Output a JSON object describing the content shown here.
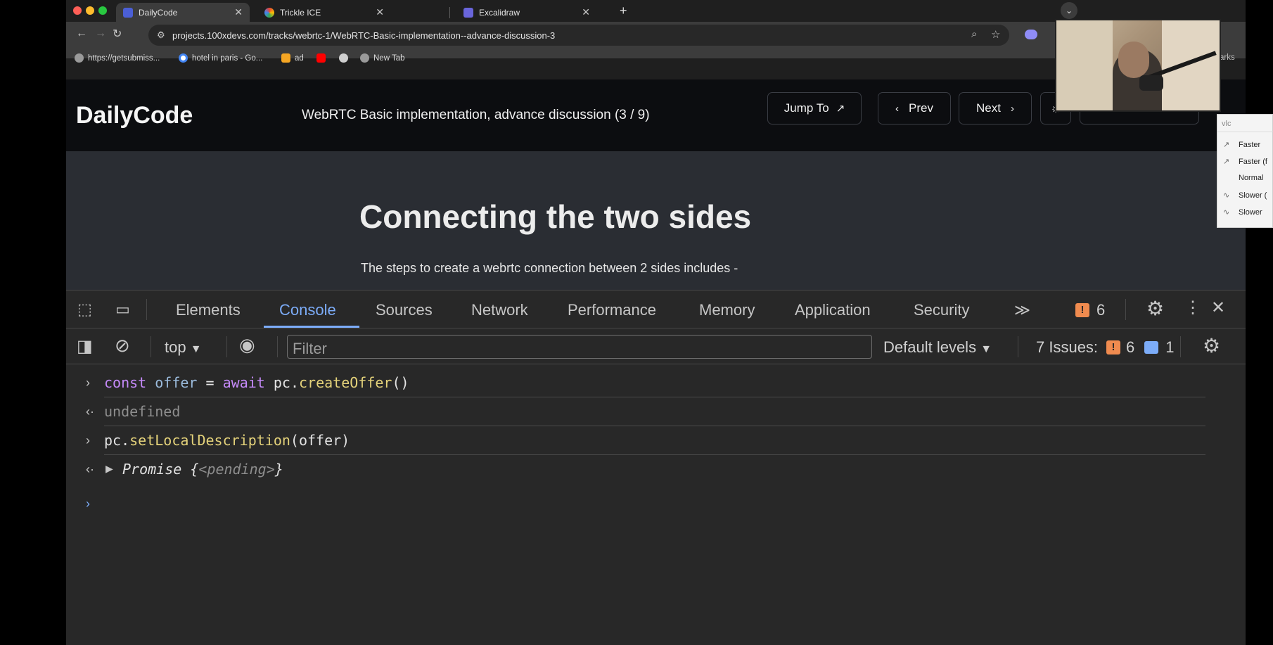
{
  "browser": {
    "tabs": [
      {
        "label": "DailyCode",
        "active": true
      },
      {
        "label": "Trickle ICE",
        "active": false
      },
      {
        "label": "Excalidraw",
        "active": false
      }
    ],
    "url": "projects.100xdevs.com/tracks/webrtc-1/WebRTC-Basic-implementation--advance-discussion-3",
    "bookmarks": [
      "https://getsubmiss...",
      "hotel in paris - Go...",
      "ad",
      "",
      "",
      "New Tab"
    ],
    "bookmarks_overflow": "arks"
  },
  "page": {
    "logo": "DailyCode",
    "lesson_title": "WebRTC Basic implementation, advance discussion (3 / 9)",
    "jump_to": "Jump To",
    "prev": "Prev",
    "next": "Next",
    "heading": "Connecting the two sides",
    "paragraph": "The steps to create a webrtc connection between 2 sides includes -"
  },
  "devtools": {
    "tabs": [
      "Elements",
      "Console",
      "Sources",
      "Network",
      "Performance",
      "Memory",
      "Application",
      "Security"
    ],
    "active_tab": "Console",
    "overflow": "≫",
    "warning_count": "6",
    "context": "top",
    "filter_placeholder": "Filter",
    "levels": "Default levels",
    "issues_label": "7 Issues:",
    "issues_warn": "6",
    "issues_info": "1"
  },
  "console": {
    "line1": {
      "kw": "const",
      "var": "offer",
      "eq": " = ",
      "kw2": "await",
      "obj": " pc.",
      "fn": "createOffer",
      "rest": "()"
    },
    "line2": "undefined",
    "line3": {
      "obj": "pc.",
      "fn": "setLocalDescription",
      "rest": "(offer)"
    },
    "line4": {
      "name": "Promise ",
      "open": "{",
      "state": "<pending>",
      "close": "}"
    }
  },
  "vlc_menu": {
    "search": "vlc",
    "items": [
      "Faster",
      "Faster (f",
      "Normal",
      "Slower (",
      "Slower"
    ]
  },
  "colors": {
    "accent": "#7cacf8",
    "warning": "#f08b4f",
    "keyword": "#c58af9",
    "function": "#e4d27a"
  }
}
